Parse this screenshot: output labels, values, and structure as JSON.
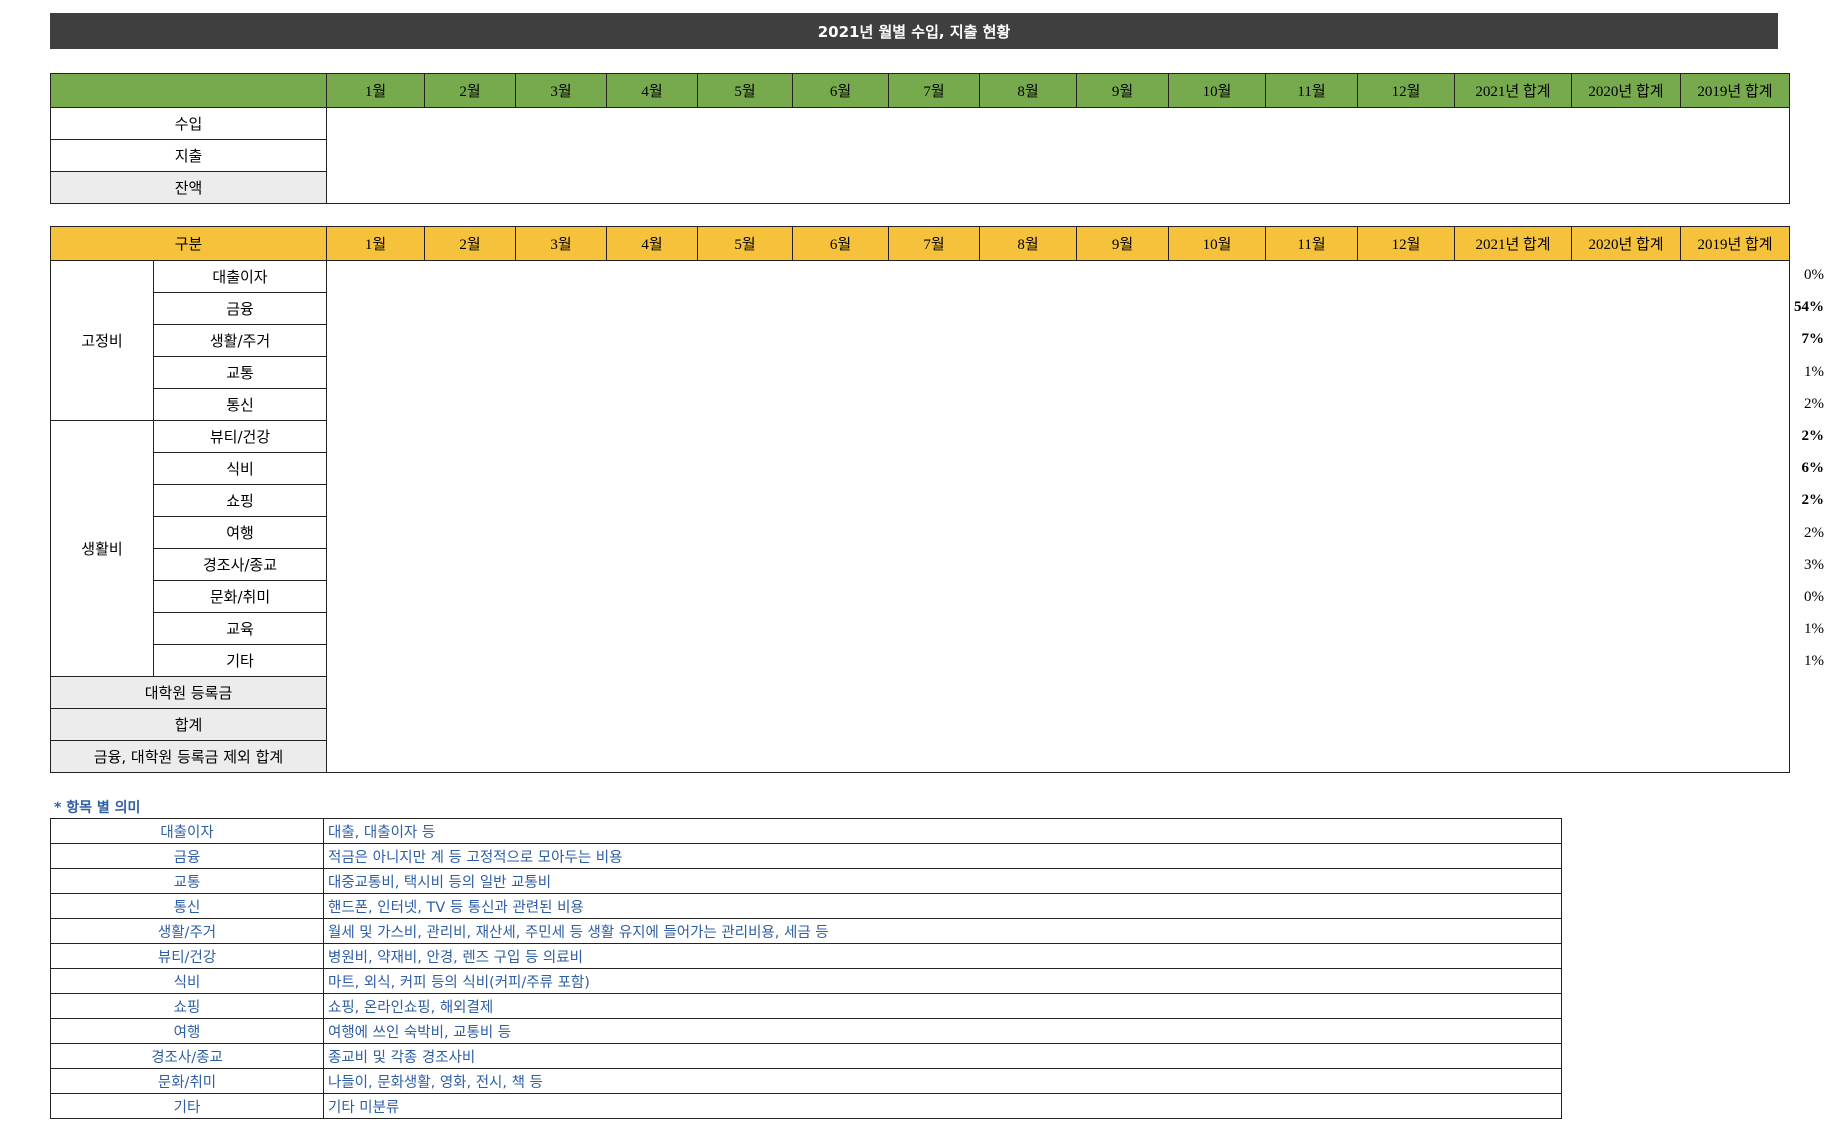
{
  "title": "2021년 월별 수입, 지출 현황",
  "months": [
    "1월",
    "2월",
    "3월",
    "4월",
    "5월",
    "6월",
    "7월",
    "8월",
    "9월",
    "10월",
    "11월",
    "12월"
  ],
  "totals": [
    "2021년 합계",
    "2020년 합계",
    "2019년 합계"
  ],
  "income": {
    "rows": [
      "수입",
      "지출",
      "잔액"
    ]
  },
  "expense": {
    "header_label": "구분",
    "groups": [
      {
        "name": "고정비",
        "items": [
          "대출이자",
          "금융",
          "생활/주거",
          "교통",
          "통신"
        ]
      },
      {
        "name": "생활비",
        "items": [
          "뷰티/건강",
          "식비",
          "쇼핑",
          "여행",
          "경조사/종교",
          "문화/취미",
          "교육",
          "기타"
        ]
      }
    ],
    "extra_rows": [
      "대학원 등록금",
      "합계",
      "금융, 대학원 등록금 제외 합계"
    ],
    "percentages": [
      {
        "value": "0%",
        "bold": false
      },
      {
        "value": "54%",
        "bold": true
      },
      {
        "value": "7%",
        "bold": true
      },
      {
        "value": "1%",
        "bold": false
      },
      {
        "value": "2%",
        "bold": false
      },
      {
        "value": "2%",
        "bold": true
      },
      {
        "value": "6%",
        "bold": true
      },
      {
        "value": "2%",
        "bold": true
      },
      {
        "value": "2%",
        "bold": false
      },
      {
        "value": "3%",
        "bold": false
      },
      {
        "value": "0%",
        "bold": false
      },
      {
        "value": "1%",
        "bold": false
      },
      {
        "value": "1%",
        "bold": false
      }
    ]
  },
  "legend": {
    "title": "* 항목 별 의미",
    "rows": [
      {
        "key": "대출이자",
        "desc": "대출, 대출이자 등"
      },
      {
        "key": "금융",
        "desc": "적금은 아니지만 계 등 고정적으로 모아두는 비용"
      },
      {
        "key": "교통",
        "desc": "대중교통비, 택시비 등의 일반 교통비"
      },
      {
        "key": "통신",
        "desc": "핸드폰, 인터넷, TV 등 통신과 관련된 비용"
      },
      {
        "key": "생활/주거",
        "desc": "월세 및 가스비, 관리비, 재산세, 주민세 등 생활 유지에 들어가는 관리비용, 세금 등"
      },
      {
        "key": "뷰티/건강",
        "desc": "병원비, 약재비, 안경, 렌즈 구입 등 의료비"
      },
      {
        "key": "식비",
        "desc": "마트, 외식, 커피 등의 식비(커피/주류 포함)"
      },
      {
        "key": "쇼핑",
        "desc": "쇼핑, 온라인쇼핑, 해외결제"
      },
      {
        "key": "여행",
        "desc": "여행에 쓰인 숙박비, 교통비 등"
      },
      {
        "key": "경조사/종교",
        "desc": "종교비 및 각종 경조사비"
      },
      {
        "key": "문화/취미",
        "desc": "나들이, 문화생활, 영화, 전시, 책 등"
      },
      {
        "key": "기타",
        "desc": "기타 미분류"
      }
    ]
  }
}
